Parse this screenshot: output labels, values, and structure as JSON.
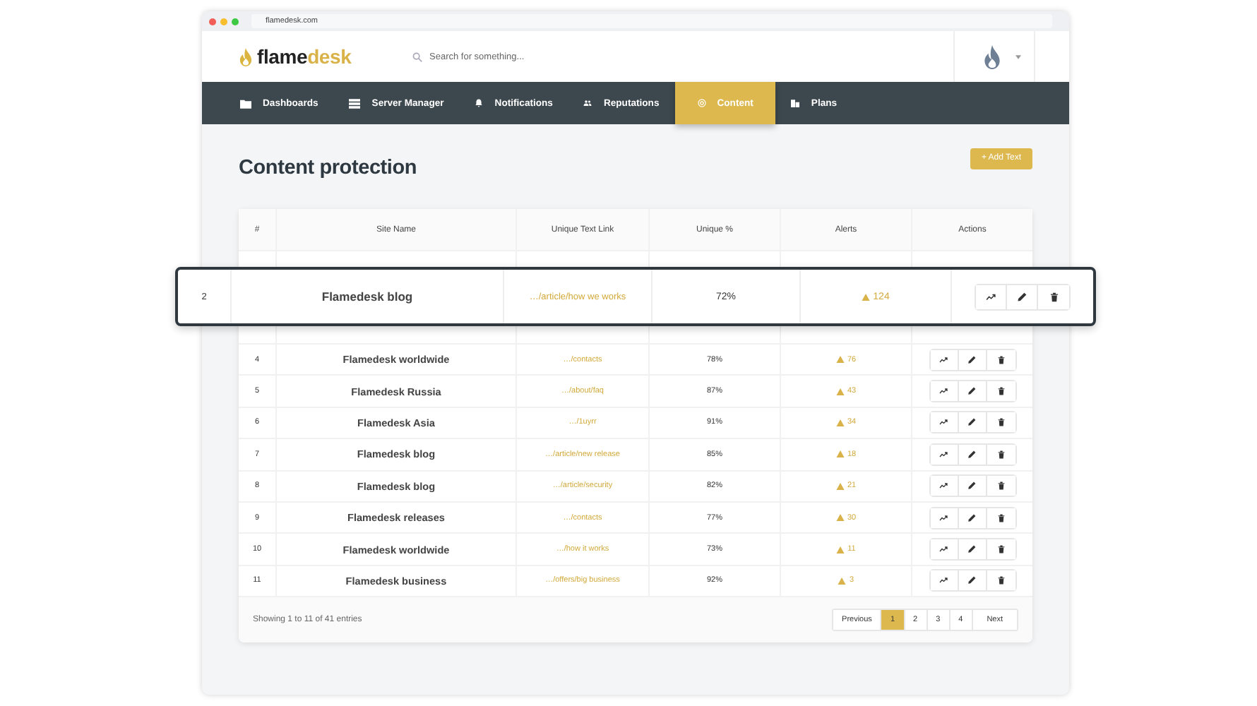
{
  "browser": {
    "url": "flamedesk.com"
  },
  "header": {
    "logo": {
      "first": "flame",
      "second": "desk"
    },
    "search": {
      "placeholder": "Search for something..."
    }
  },
  "nav": [
    {
      "label": "Dashboards",
      "selected": false
    },
    {
      "label": "Server Manager",
      "selected": false
    },
    {
      "label": "Notifications",
      "selected": false
    },
    {
      "label": "Reputations",
      "selected": false
    },
    {
      "label": "Content",
      "selected": true
    },
    {
      "label": "Plans",
      "selected": false
    }
  ],
  "page": {
    "title": "Content protection",
    "add_button": "+ Add Text"
  },
  "table": {
    "columns": [
      "#",
      "Site Name",
      "Unique Text Link",
      "Unique %",
      "Alerts",
      "Actions"
    ],
    "rows": [
      {
        "num": "4",
        "site": "Flamedesk worldwide",
        "link": "…/contacts",
        "unique": "78%",
        "alerts": "76"
      },
      {
        "num": "5",
        "site": "Flamedesk Russia",
        "link": "…/about/faq",
        "unique": "87%",
        "alerts": "43"
      },
      {
        "num": "6",
        "site": "Flamedesk Asia",
        "link": "…/1uyrr",
        "unique": "91%",
        "alerts": "34"
      },
      {
        "num": "7",
        "site": "Flamedesk blog",
        "link": "…/article/new release",
        "unique": "85%",
        "alerts": "18"
      },
      {
        "num": "8",
        "site": "Flamedesk blog",
        "link": "…/article/security",
        "unique": "82%",
        "alerts": "21"
      },
      {
        "num": "9",
        "site": "Flamedesk releases",
        "link": "…/contacts",
        "unique": "77%",
        "alerts": "30"
      },
      {
        "num": "10",
        "site": "Flamedesk worldwide",
        "link": "…/how it works",
        "unique": "73%",
        "alerts": "11"
      },
      {
        "num": "11",
        "site": "Flamedesk business",
        "link": "…/offers/big business",
        "unique": "92%",
        "alerts": "3"
      }
    ],
    "raised_row": {
      "num": "2",
      "site": "Flamedesk blog",
      "link": "…/article/how we works",
      "unique": "72%",
      "alerts": "124"
    },
    "footer": {
      "info": "Showing 1 to 11 of 41 entries",
      "pagination": [
        {
          "label": "Previous",
          "selected": false
        },
        {
          "label": "1",
          "selected": true
        },
        {
          "label": "2",
          "selected": false
        },
        {
          "label": "3",
          "selected": false
        },
        {
          "label": "4",
          "selected": false
        },
        {
          "label": "Next",
          "selected": false
        }
      ]
    }
  }
}
